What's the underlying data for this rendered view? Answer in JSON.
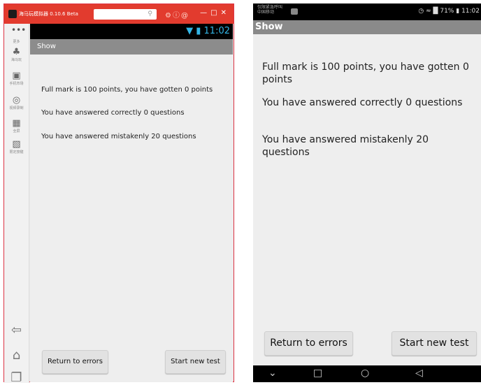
{
  "emulator": {
    "window_title": "海马玩模拟器 0.10.6 Beta",
    "sidebar": {
      "items": [
        {
          "label": "更多",
          "icon": "more-icon"
        },
        {
          "label": "海马玩",
          "icon": "app-store-icon"
        },
        {
          "label": "手机市场",
          "icon": "phone-market-icon"
        },
        {
          "label": "视频录制",
          "icon": "video-record-icon"
        },
        {
          "label": "全屏",
          "icon": "fullscreen-icon"
        },
        {
          "label": "限定按键",
          "icon": "keymap-icon"
        }
      ]
    },
    "status_time": "11:02",
    "action_bar_title": "Show",
    "messages": {
      "full_mark": "Full mark is 100 points, you have gotten 0 points",
      "correct": "You have answered correctly 0 questions",
      "mistaken": "You have answered mistakenly 20 questions"
    },
    "buttons": {
      "return_errors": "Return to errors",
      "start_new": "Start new test"
    }
  },
  "device": {
    "carrier_line1": "仅限紧急呼叫",
    "carrier_line2": "中国移动",
    "status_right": "71%",
    "status_time": "11:02",
    "action_bar_title": "Show",
    "messages": {
      "full_mark": "Full mark is 100 points, you have gotten 0 points",
      "correct": "You have answered correctly 0 questions",
      "mistaken": "You have answered mistakenly 20 questions"
    },
    "buttons": {
      "return_errors": "Return to errors",
      "start_new": "Start new test"
    }
  }
}
